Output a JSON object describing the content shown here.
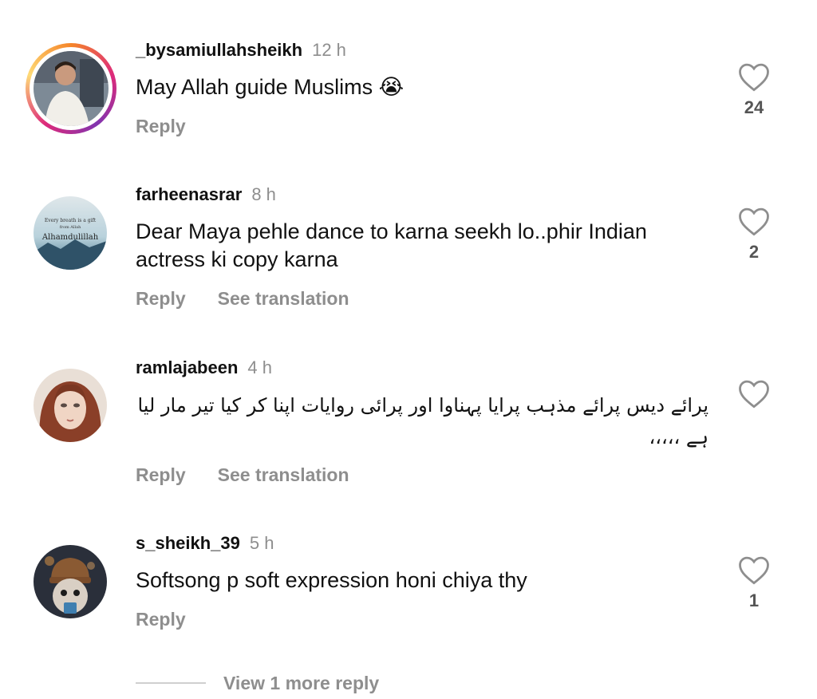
{
  "comments": [
    {
      "username": "_bysamiullahsheikh",
      "time": "12 h",
      "text": "May Allah guide Muslims 😭",
      "reply": "Reply",
      "likes": "24"
    },
    {
      "username": "farheenasrar",
      "time": "8 h",
      "text": "Dear Maya pehle dance to karna seekh lo..phir Indian actress ki copy karna",
      "reply": "Reply",
      "translate": "See translation",
      "likes": "2",
      "avatar_text": {
        "line1": "Every breath is a gift",
        "line2": "from Allah",
        "line3": "Alhamdulillah"
      }
    },
    {
      "username": "ramlajabeen",
      "time": "4 h",
      "text": "پرائے دیس پرائے مذہب پرایا پہناوا  اور پرائی روایات اپنا کر کیا تیر مار لیا ہے ،،،،،",
      "reply": "Reply",
      "translate": "See translation",
      "likes": ""
    },
    {
      "username": "s_sheikh_39",
      "time": "5 h",
      "text": "Softsong p soft expression honi chiya thy",
      "reply": "Reply",
      "likes": "1"
    }
  ],
  "view_more": "View 1 more reply",
  "colors": {
    "muted": "#8e8e8e",
    "text": "#111111",
    "ring": [
      "#f58529",
      "#dd2a7b",
      "#8134af"
    ]
  }
}
